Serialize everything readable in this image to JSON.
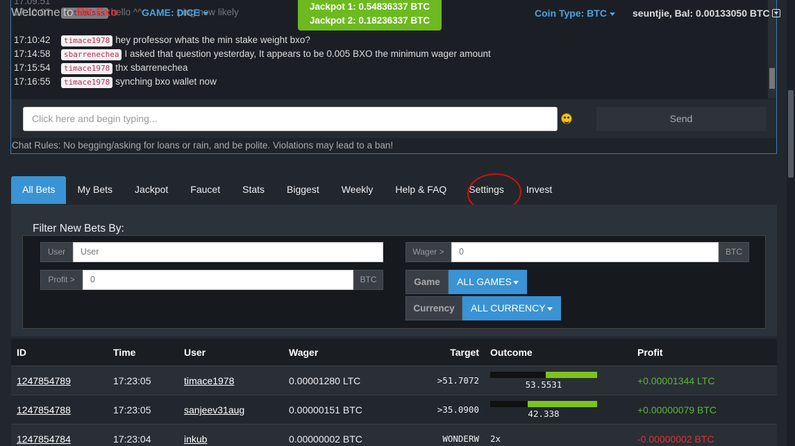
{
  "topbar": {
    "welcome_prefix": "Welcome to",
    "brand": "Bit-Exo",
    "game_label": "GAME: DICE",
    "jackpot1": "Jackpot 1: 0.54836337 BTC",
    "jackpot2": "Jackpot 2: 0.18236337 BTC",
    "coin_type": "Coin Type: BTC",
    "balance": "seuntjie, Bal: 0.00133050 BTC"
  },
  "chat": {
    "messages": [
      {
        "time": "17:10:07",
        "user": "tetheusss",
        "text": "hello ^^"
      },
      {
        "time": "17:10:42",
        "user": "timace1978",
        "text": "hey professor whats the min stake weight bxo?"
      },
      {
        "time": "17:14:58",
        "user": "sbarrenechea",
        "text": "I asked that question yesterday, It appears to be 0.005 BXO the minimum wager amount"
      },
      {
        "time": "17:15:54",
        "user": "timace1978",
        "text": "thx sbarrenechea"
      },
      {
        "time": "17:16:55",
        "user": "timace1978",
        "text": "synching bxo wallet now"
      }
    ],
    "partial_text": "ping now likely",
    "input_placeholder": "Click here and begin typing...",
    "send_label": "Send",
    "rules": "Chat Rules: No begging/asking for loans or rain, and be polite. Violations may lead to a ban!"
  },
  "tabs": [
    "All Bets",
    "My Bets",
    "Jackpot",
    "Faucet",
    "Stats",
    "Biggest",
    "Weekly",
    "Help & FAQ",
    "Settings",
    "Invest"
  ],
  "filter": {
    "title": "Filter New Bets By:",
    "user_addon": "User",
    "user_placeholder": "User",
    "profit_addon": "Profit >",
    "profit_value": "0",
    "profit_unit": "BTC",
    "wager_addon": "Wager >",
    "wager_value": "0",
    "wager_unit": "BTC",
    "game_label": "Game",
    "game_value": "ALL GAMES",
    "currency_label": "Currency",
    "currency_value": "ALL CURRENCY"
  },
  "table": {
    "headers": {
      "id": "ID",
      "time": "Time",
      "user": "User",
      "wager": "Wager",
      "target": "Target",
      "outcome": "Outcome",
      "profit": "Profit"
    },
    "rows": [
      {
        "id": "1247854789",
        "time": "17:23:05",
        "user": "timace1978",
        "wager": "0.00001280 LTC",
        "target": ">51.7072",
        "outcome": "53.5531",
        "roll_fraction": 0.535531,
        "win_fraction": 0.482928,
        "profit": "+0.00001344 LTC",
        "profit_positive": true
      },
      {
        "id": "1247854788",
        "time": "17:23:05",
        "user": "sanjeev31aug",
        "wager": "0.00000151 BTC",
        "target": ">35.0900",
        "outcome": "42.338",
        "roll_fraction": 0.42338,
        "win_fraction": 0.6491,
        "profit": "+0.00000079 BTC",
        "profit_positive": true
      },
      {
        "id": "1247854784",
        "time": "17:23:04",
        "user": "inkub",
        "wager": "0.00000002 BTC",
        "target": "WONDERW",
        "outcome": "2x",
        "profit": "-0.00000002 BTC",
        "profit_positive": false
      }
    ]
  },
  "colors": {
    "accent": "#3a93d4",
    "jackpot": "#6cba1f",
    "brand": "#ff2a2a",
    "positive": "#5cb43a",
    "negative": "#e53030"
  }
}
